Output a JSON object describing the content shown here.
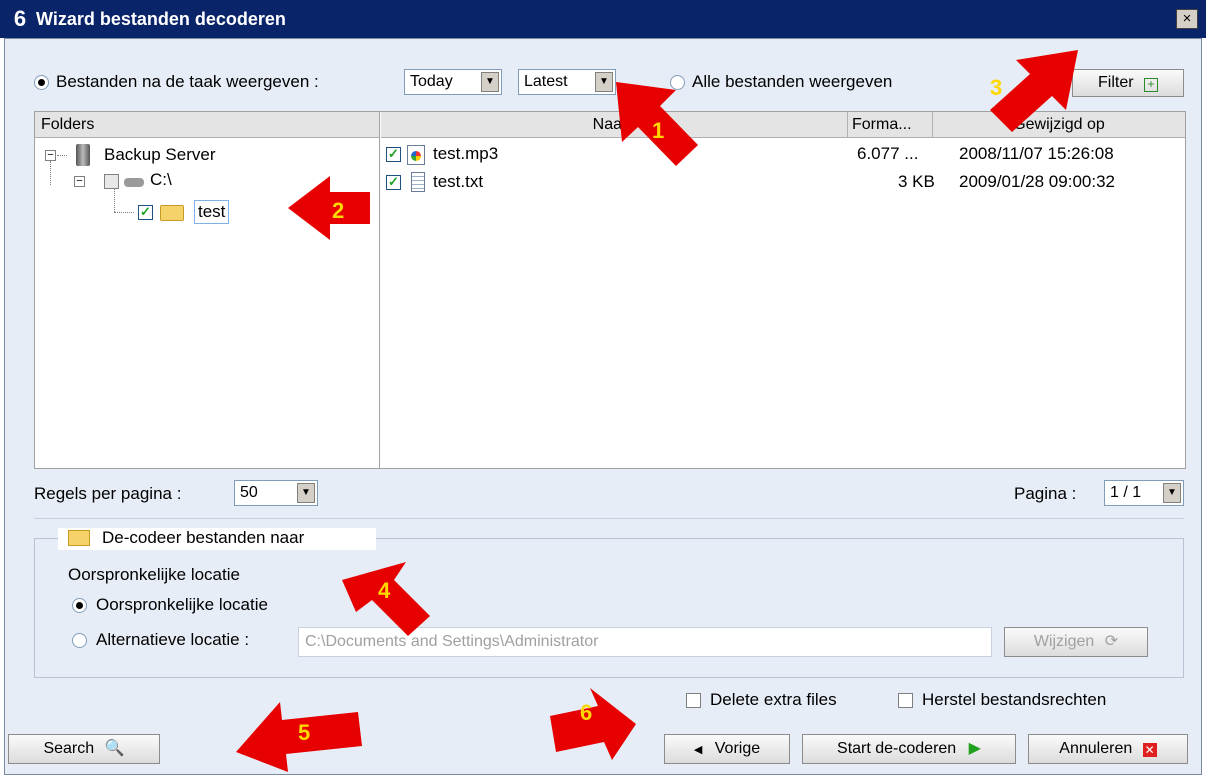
{
  "window": {
    "title": "Wizard bestanden decoderen",
    "logo": "6",
    "close_label": "×"
  },
  "filter_bar": {
    "show_after_task_label": "Bestanden na de taak weergeven :",
    "day_select": "Today",
    "version_select": "Latest",
    "show_all_label": "Alle bestanden weergeven",
    "filter_button": "Filter"
  },
  "tree": {
    "header": "Folders",
    "nodes": [
      {
        "label": "Backup Server",
        "icon": "server-icon"
      },
      {
        "label": "C:\\",
        "icon": "drive-icon"
      },
      {
        "label": "test",
        "icon": "folder-icon",
        "checked": true
      }
    ]
  },
  "file_table": {
    "columns": [
      "Naam",
      "Forma...",
      "Gewijzigd op"
    ],
    "rows": [
      {
        "name": "test.mp3",
        "size": "6.077 ...",
        "modified": "2008/11/07 15:26:08",
        "checked": true,
        "icon": "media-file-icon"
      },
      {
        "name": "test.txt",
        "size": "3 KB",
        "modified": "2009/01/28 09:00:32",
        "checked": true,
        "icon": "text-file-icon"
      }
    ]
  },
  "pagination": {
    "rows_per_page_label": "Regels per pagina :",
    "rows_per_page": "50",
    "page_label": "Pagina :",
    "page": "1 / 1"
  },
  "restore": {
    "group_title": "De-codeer bestanden naar",
    "location_label": "Oorspronkelijke locatie",
    "original_option": "Oorspronkelijke locatie",
    "alternative_option": "Alternatieve locatie :",
    "alternative_path": "C:\\Documents and Settings\\Administrator",
    "change_button": "Wijzigen"
  },
  "options": {
    "delete_extra": "Delete extra files",
    "restore_permissions": "Herstel bestandsrechten"
  },
  "buttons": {
    "search": "Search",
    "back": "Vorige",
    "start": "Start de-coderen",
    "cancel": "Annuleren"
  },
  "markers": [
    "1",
    "2",
    "3",
    "4",
    "5",
    "6"
  ],
  "colors": {
    "marker_fill": "#e60000",
    "marker_text": "#ffd800",
    "title_bar": "#0a246a"
  }
}
